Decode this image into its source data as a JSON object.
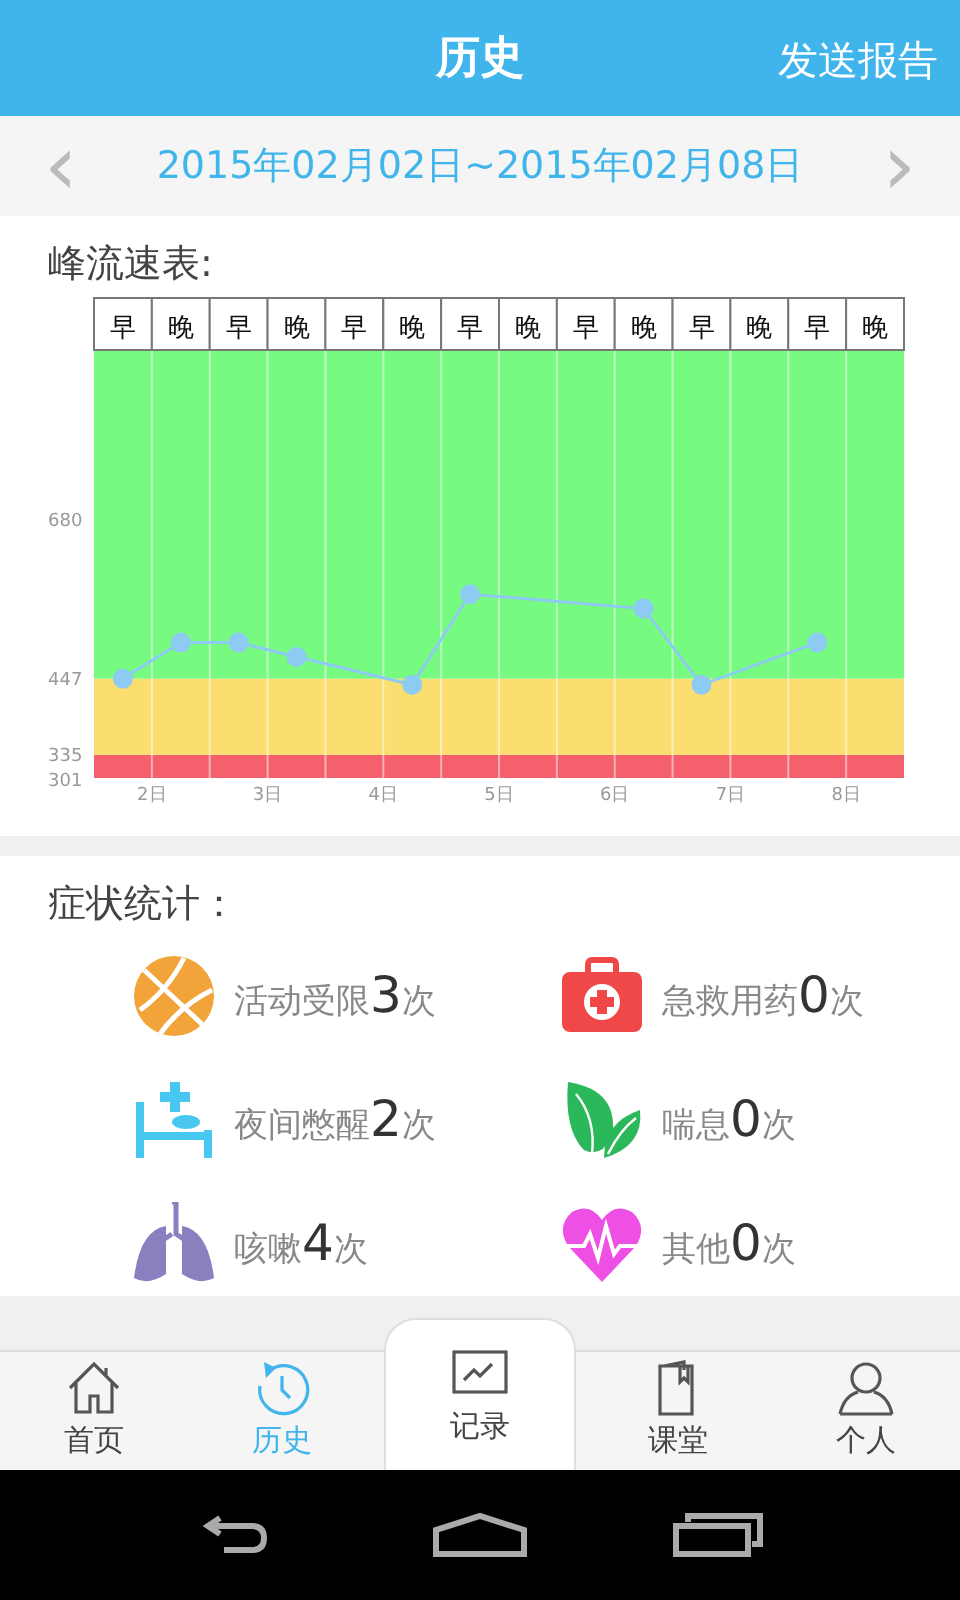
{
  "header": {
    "title": "历史",
    "action": "发送报告"
  },
  "date_range": {
    "text": "2015年02月02日~2015年02月08日",
    "prev": "‹",
    "next": "›"
  },
  "peak_flow": {
    "title": "峰流速表:",
    "chart_data": {
      "type": "line",
      "categories": [
        "早",
        "晚",
        "早",
        "晚",
        "早",
        "晚",
        "早",
        "晚",
        "早",
        "晚",
        "早",
        "晚",
        "早",
        "晚"
      ],
      "yticks": [
        301,
        335,
        447,
        680
      ],
      "ylim": [
        301,
        930
      ],
      "series": [
        {
          "color": "#8ecbf2",
          "marker": "circle",
          "values": [
            447,
            500,
            500,
            479,
            null,
            438,
            571,
            null,
            null,
            550,
            438,
            null,
            500,
            null
          ]
        }
      ],
      "bands": [
        {
          "axis": "y",
          "from": 301,
          "to": 335,
          "color": "#f4606c"
        },
        {
          "axis": "y",
          "from": 335,
          "to": 447,
          "color": "#fade70"
        },
        {
          "axis": "y",
          "from": 447,
          "to": 930,
          "color": "#76fb80"
        }
      ]
    },
    "date_labels": [
      "2日",
      "3日",
      "4日",
      "5日",
      "6日",
      "7日",
      "8日"
    ]
  },
  "symptoms": {
    "title": "症状统计：",
    "items": [
      {
        "kind": "basketball",
        "label": "活动受限",
        "count": "3",
        "unit": "次"
      },
      {
        "kind": "medkit",
        "label": "急救用药",
        "count": "0",
        "unit": "次"
      },
      {
        "kind": "bed",
        "label": "夜间憋醒",
        "count": "2",
        "unit": "次"
      },
      {
        "kind": "leaf",
        "label": "喘息",
        "count": "0",
        "unit": "次"
      },
      {
        "kind": "lungs",
        "label": "咳嗽",
        "count": "4",
        "unit": "次"
      },
      {
        "kind": "heart",
        "label": "其他",
        "count": "0",
        "unit": "次"
      }
    ]
  },
  "tabs": [
    {
      "kind": "home",
      "label": "首页",
      "selected": false,
      "raised": false
    },
    {
      "kind": "history",
      "label": "历史",
      "selected": true,
      "raised": false
    },
    {
      "kind": "record",
      "label": "记录",
      "selected": false,
      "raised": true
    },
    {
      "kind": "book",
      "label": "课堂",
      "selected": false,
      "raised": false
    },
    {
      "kind": "person",
      "label": "个人",
      "selected": false,
      "raised": false
    }
  ]
}
